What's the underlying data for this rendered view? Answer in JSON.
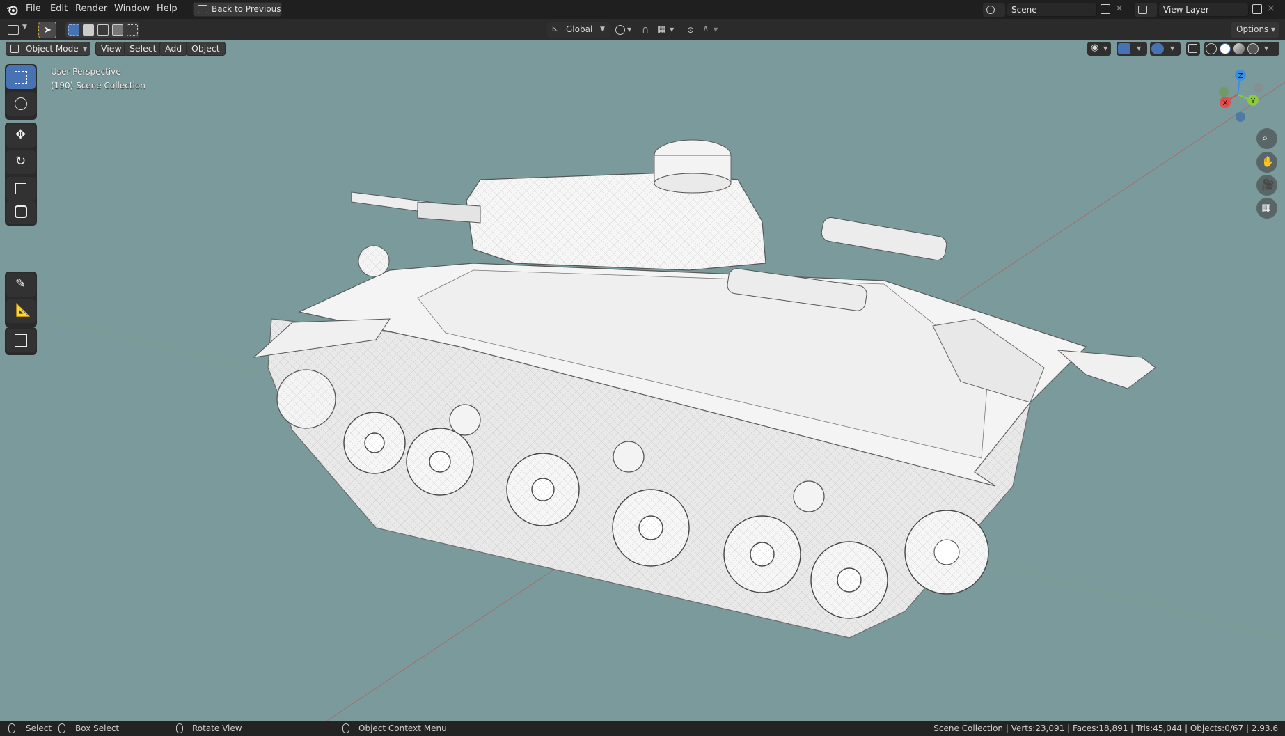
{
  "menu": {
    "items": [
      "File",
      "Edit",
      "Render",
      "Window",
      "Help"
    ],
    "back_button": "Back to Previous"
  },
  "scene": {
    "label": "Scene"
  },
  "view_layer": {
    "label": "View Layer"
  },
  "tool_header": {
    "transform_orientation": "Global",
    "options": "Options"
  },
  "viewport_header": {
    "mode": "Object Mode",
    "view": "View",
    "select": "Select",
    "add": "Add",
    "object": "Object"
  },
  "viewport": {
    "perspective": "User Perspective",
    "collection": "(190) Scene Collection"
  },
  "axis_gizmo": {
    "x": "X",
    "y": "Y",
    "z": "Z"
  },
  "toolbar_icons": [
    "select-box-icon",
    "cursor-icon",
    "move-icon",
    "rotate-icon",
    "scale-icon",
    "transform-icon",
    "annotate-icon",
    "measure-icon",
    "add-cube-icon"
  ],
  "status": {
    "select": "Select",
    "box_select": "Box Select",
    "rotate_view": "Rotate View",
    "context_menu": "Object Context Menu",
    "stats": "Scene Collection | Verts:23,091 | Faces:18,891 | Tris:45,044 | Objects:0/67 | 2.93.6"
  },
  "colors": {
    "viewport_bg": "#7a9a9c",
    "active_tool": "#4772b3",
    "x_axis": "#e24c4c",
    "y_axis": "#8bcb3a",
    "z_axis": "#3d8ee0"
  }
}
